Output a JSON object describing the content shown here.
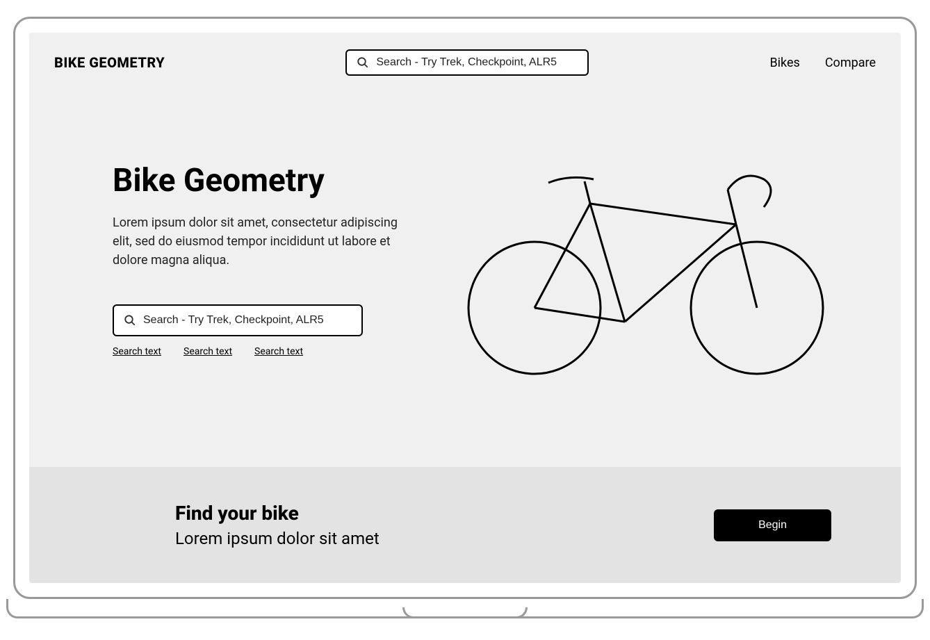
{
  "header": {
    "logo": "BIKE GEOMETRY",
    "search_placeholder": "Search - Try Trek, Checkpoint, ALR5",
    "nav": [
      {
        "label": "Bikes"
      },
      {
        "label": "Compare"
      }
    ]
  },
  "hero": {
    "title": "Bike Geometry",
    "description": "Lorem ipsum dolor sit amet, consectetur adipiscing elit, sed do eiusmod tempor incididunt ut labore et dolore magna aliqua.",
    "search_placeholder": "Search - Try Trek, Checkpoint, ALR5",
    "suggestions": [
      {
        "label": "Search text"
      },
      {
        "label": "Search text"
      },
      {
        "label": "Search text"
      }
    ]
  },
  "cta": {
    "title": "Find your bike",
    "subtitle": "Lorem ipsum dolor sit amet",
    "button_label": "Begin"
  }
}
